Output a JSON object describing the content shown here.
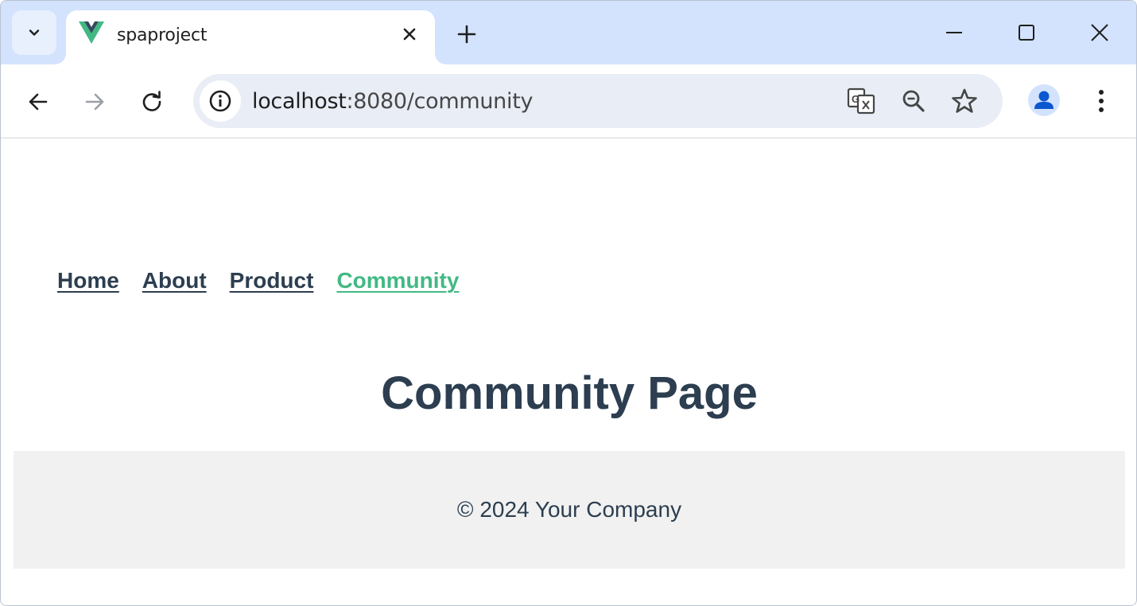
{
  "browser": {
    "tab": {
      "title": "spaproject",
      "favicon": "vue-logo-icon",
      "favicon_colors": {
        "outer": "#42b883",
        "inner": "#35495e"
      }
    },
    "address_bar": {
      "host": "localhost",
      "path": ":8080/community"
    },
    "colors": {
      "tabstrip_bg": "#d3e3fd",
      "omnibox_bg": "#e9edf6",
      "profile_accent": "#0b57d0"
    }
  },
  "page": {
    "nav": {
      "items": [
        {
          "label": "Home",
          "active": false
        },
        {
          "label": "About",
          "active": false
        },
        {
          "label": "Product",
          "active": false
        },
        {
          "label": "Community",
          "active": true
        }
      ],
      "link_color": "#2c3e50",
      "active_color": "#42b983"
    },
    "title": "Community Page",
    "footer": {
      "text": "© 2024 Your Company",
      "bg": "#f1f1f1"
    }
  }
}
